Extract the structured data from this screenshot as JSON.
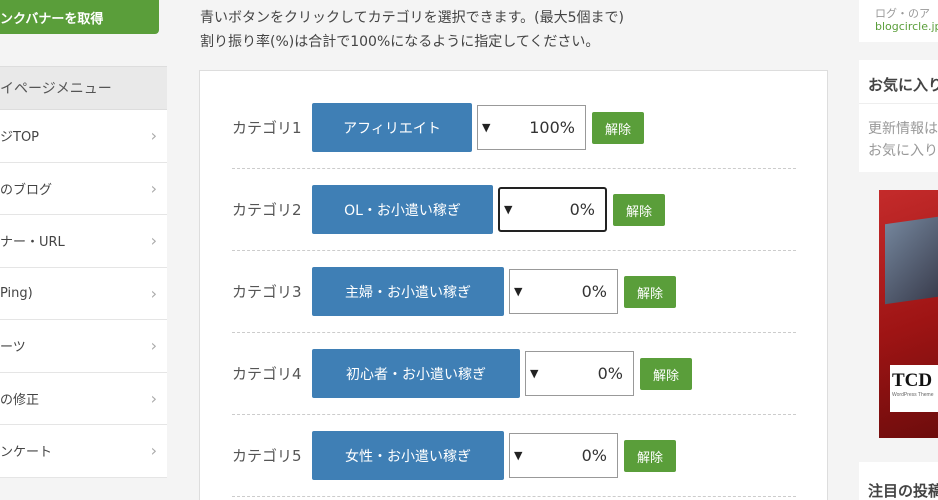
{
  "sidebar": {
    "banner_button": "ンクバナーを取得",
    "menu_title": "イページメニュー",
    "items": [
      {
        "label": "ジTOP"
      },
      {
        "label": "のブログ"
      },
      {
        "label": "ナー・URL"
      },
      {
        "label": "Ping)"
      },
      {
        "label": "ーツ"
      },
      {
        "label": "の修正"
      },
      {
        "label": "ンケート"
      }
    ]
  },
  "main": {
    "intro_line1": "青いボタンをクリックしてカテゴリを選択できます。(最大5個まで)",
    "intro_line2": "割り振り率(%)は合計で100%になるように指定してください。",
    "rows": [
      {
        "label": "カテゴリ1",
        "category": "アフィリエイト",
        "percent": "100%",
        "clear": "解除"
      },
      {
        "label": "カテゴリ2",
        "category": "OL・お小遣い稼ぎ",
        "percent": "0%",
        "clear": "解除"
      },
      {
        "label": "カテゴリ3",
        "category": "主婦・お小遣い稼ぎ",
        "percent": "0%",
        "clear": "解除"
      },
      {
        "label": "カテゴリ4",
        "category": "初心者・お小遣い稼ぎ",
        "percent": "0%",
        "clear": "解除"
      },
      {
        "label": "カテゴリ5",
        "category": "女性・お小遣い稼ぎ",
        "percent": "0%",
        "clear": "解除"
      }
    ]
  },
  "right": {
    "top_text": "ログ・のア",
    "top_link": "blogcircle.jp",
    "fav_title": "お気に入り",
    "fav_line1": "更新情報は",
    "fav_line2": "お気に入り",
    "ad_logo": "TCD",
    "ad_logo_sub": "WordPress Theme",
    "featured_title": "注目の投稿"
  },
  "colors": {
    "category_button": "#3f7fb5",
    "clear_button": "#5a9e3a"
  }
}
